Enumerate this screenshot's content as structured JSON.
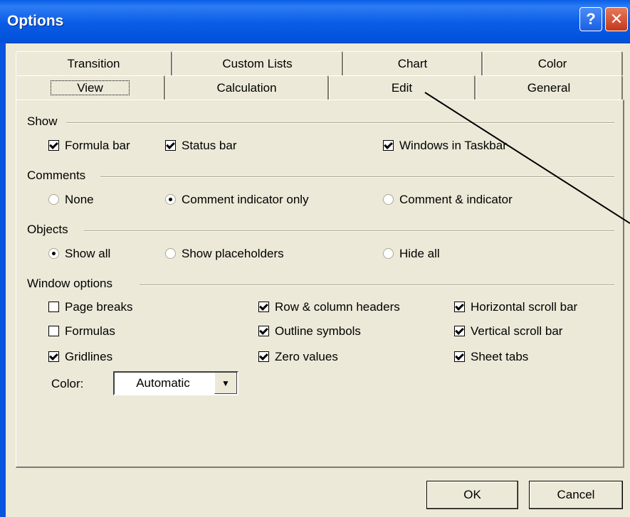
{
  "window": {
    "title": "Options"
  },
  "titlebar": {
    "help_glyph": "?",
    "close_glyph": "✕"
  },
  "tabs_back": [
    "Transition",
    "Custom Lists",
    "Chart",
    "Color"
  ],
  "tabs_front": [
    "View",
    "Calculation",
    "Edit",
    "General"
  ],
  "active_tab": "View",
  "show": {
    "label": "Show",
    "formula_bar": {
      "label": "Formula bar",
      "checked": true
    },
    "status_bar": {
      "label": "Status bar",
      "checked": true
    },
    "windows_in_taskbar": {
      "label": "Windows in Taskbar",
      "checked": true
    }
  },
  "comments": {
    "label": "Comments",
    "none": {
      "label": "None",
      "selected": false
    },
    "indicator_only": {
      "label": "Comment indicator only",
      "selected": true
    },
    "comment_and_indicator": {
      "label": "Comment & indicator",
      "selected": false
    }
  },
  "objects": {
    "label": "Objects",
    "show_all": {
      "label": "Show all",
      "selected": true
    },
    "show_placeholders": {
      "label": "Show placeholders",
      "selected": false
    },
    "hide_all": {
      "label": "Hide all",
      "selected": false
    }
  },
  "window_options": {
    "label": "Window options",
    "page_breaks": {
      "label": "Page breaks",
      "checked": false
    },
    "formulas": {
      "label": "Formulas",
      "checked": false
    },
    "gridlines": {
      "label": "Gridlines",
      "checked": true
    },
    "row_col_headers": {
      "label": "Row & column headers",
      "checked": true
    },
    "outline_symbols": {
      "label": "Outline symbols",
      "checked": true
    },
    "zero_values": {
      "label": "Zero values",
      "checked": true
    },
    "horizontal_scroll": {
      "label": "Horizontal scroll bar",
      "checked": true
    },
    "vertical_scroll": {
      "label": "Vertical scroll bar",
      "checked": true
    },
    "sheet_tabs": {
      "label": "Sheet tabs",
      "checked": true
    },
    "color_label": "Color:",
    "color_value": "Automatic",
    "dropdown_glyph": "▼"
  },
  "buttons": {
    "ok": "OK",
    "cancel": "Cancel"
  },
  "colors": {
    "titlebar": "#0a5ce6",
    "dialog": "#ece9d8"
  }
}
